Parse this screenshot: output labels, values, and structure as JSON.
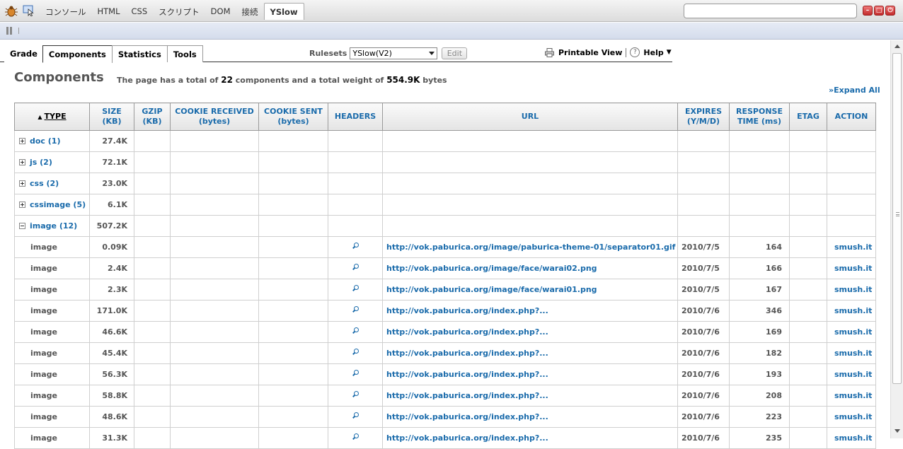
{
  "firebug": {
    "tabs": [
      "コンソール",
      "HTML",
      "CSS",
      "スクリプト",
      "DOM",
      "接続",
      "YSlow"
    ],
    "active_tab": "YSlow",
    "search_value": ""
  },
  "yslow": {
    "tabs": [
      "Grade",
      "Components",
      "Statistics",
      "Tools"
    ],
    "active_tab": "Components",
    "rulesets_label": "Rulesets",
    "ruleset_value": "YSlow(V2)",
    "edit_label": "Edit",
    "printable_view_label": "Printable View",
    "help_label": "Help",
    "help_arrow": "▼"
  },
  "components": {
    "title": "Components",
    "summary_prefix": "The page has a total of ",
    "total_count": "22",
    "summary_mid": " components and a total weight of ",
    "total_weight": "554.9K",
    "summary_suffix": " bytes",
    "expand_all": "»Expand All",
    "columns": {
      "type": "TYPE",
      "size_1": "SIZE",
      "size_2": "(KB)",
      "gzip_1": "GZIP",
      "gzip_2": "(KB)",
      "cookie_recv_1": "COOKIE RECEIVED",
      "cookie_recv_2": "(bytes)",
      "cookie_sent_1": "COOKIE SENT",
      "cookie_sent_2": "(bytes)",
      "headers": "HEADERS",
      "url": "URL",
      "expires_1": "EXPIRES",
      "expires_2": "(Y/M/D)",
      "resp_1": "RESPONSE",
      "resp_2": "TIME (ms)",
      "etag": "ETAG",
      "action": "ACTION"
    },
    "sort_arrow": "▲",
    "groups": [
      {
        "label": "doc (1)",
        "size": "27.4K",
        "expanded": false
      },
      {
        "label": "js (2)",
        "size": "72.1K",
        "expanded": false
      },
      {
        "label": "css (2)",
        "size": "23.0K",
        "expanded": false
      },
      {
        "label": "cssimage (5)",
        "size": "6.1K",
        "expanded": false
      },
      {
        "label": "image (12)",
        "size": "507.2K",
        "expanded": true
      }
    ],
    "rows": [
      {
        "type": "image",
        "size": "0.09K",
        "url": "http://vok.paburica.org/image/paburica-theme-01/separator01.gif",
        "expires": "2010/7/5",
        "response": "164",
        "action": "smush.it"
      },
      {
        "type": "image",
        "size": "2.4K",
        "url": "http://vok.paburica.org/image/face/warai02.png",
        "expires": "2010/7/5",
        "response": "166",
        "action": "smush.it"
      },
      {
        "type": "image",
        "size": "2.3K",
        "url": "http://vok.paburica.org/image/face/warai01.png",
        "expires": "2010/7/5",
        "response": "167",
        "action": "smush.it"
      },
      {
        "type": "image",
        "size": "171.0K",
        "url": "http://vok.paburica.org/index.php?...",
        "expires": "2010/7/6",
        "response": "346",
        "action": "smush.it"
      },
      {
        "type": "image",
        "size": "46.6K",
        "url": "http://vok.paburica.org/index.php?...",
        "expires": "2010/7/6",
        "response": "169",
        "action": "smush.it"
      },
      {
        "type": "image",
        "size": "45.4K",
        "url": "http://vok.paburica.org/index.php?...",
        "expires": "2010/7/6",
        "response": "182",
        "action": "smush.it"
      },
      {
        "type": "image",
        "size": "56.3K",
        "url": "http://vok.paburica.org/index.php?...",
        "expires": "2010/7/6",
        "response": "193",
        "action": "smush.it"
      },
      {
        "type": "image",
        "size": "58.8K",
        "url": "http://vok.paburica.org/index.php?...",
        "expires": "2010/7/6",
        "response": "208",
        "action": "smush.it"
      },
      {
        "type": "image",
        "size": "48.6K",
        "url": "http://vok.paburica.org/index.php?...",
        "expires": "2010/7/6",
        "response": "223",
        "action": "smush.it"
      },
      {
        "type": "image",
        "size": "31.3K",
        "url": "http://vok.paburica.org/index.php?...",
        "expires": "2010/7/6",
        "response": "235",
        "action": "smush.it"
      }
    ]
  }
}
